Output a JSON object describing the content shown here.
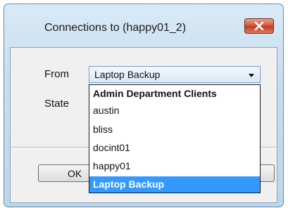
{
  "dialog": {
    "title": "Connections to (happy01_2)"
  },
  "form": {
    "from_label": "From",
    "from_value": "Laptop Backup",
    "state_label": "State"
  },
  "dropdown": {
    "group_header": "Admin Department Clients",
    "items": [
      "austin",
      "bliss",
      "docint01",
      "happy01"
    ],
    "selected": "Laptop Backup"
  },
  "buttons": {
    "ok": "OK"
  },
  "icons": {
    "close": "close-icon",
    "dropdown_arrow": "chevron-down-icon"
  },
  "colors": {
    "selection": "#3399ff",
    "close_button": "#c23a1e"
  }
}
